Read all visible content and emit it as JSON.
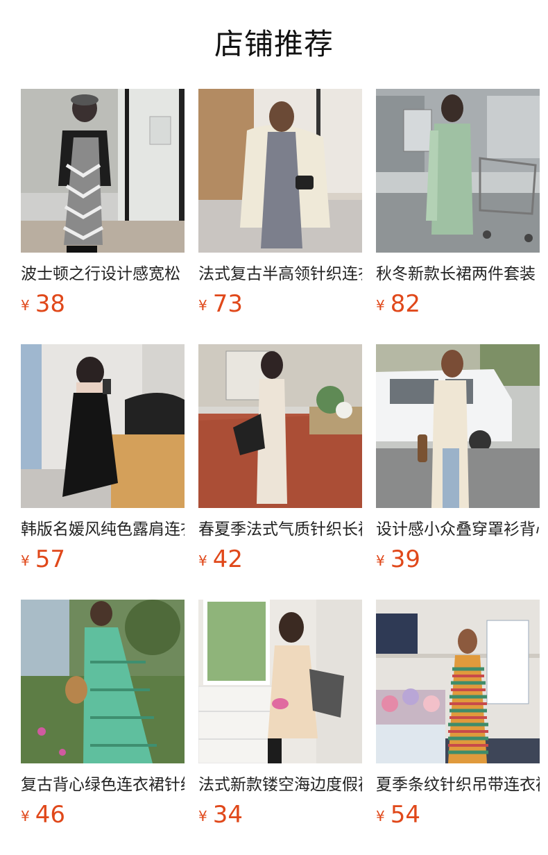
{
  "page_title": "店铺推荐",
  "currency_symbol": "¥",
  "colors": {
    "price": "#e0481a",
    "title": "#111111"
  },
  "products": [
    {
      "name": "波士顿之行设计感宽松",
      "price": "38",
      "image": "woman-leather-jacket-chevron-knit-dress"
    },
    {
      "name": "法式复古半高领针织连衣裙",
      "price": "73",
      "image": "woman-grey-knit-dress-on-cream-sofa"
    },
    {
      "name": "秋冬新款长裙两件套装",
      "price": "82",
      "image": "woman-mint-cardigan-set-in-supermarket"
    },
    {
      "name": "韩版名媛风纯色露肩连衣裙",
      "price": "57",
      "image": "woman-black-tube-dress-mirror-selfie"
    },
    {
      "name": "春夏季法式气质针织长裙",
      "price": "42",
      "image": "woman-cream-crochet-dress-street"
    },
    {
      "name": "设计感小众叠穿罩衫背心",
      "price": "39",
      "image": "woman-cream-long-vest-jeans-by-car"
    },
    {
      "name": "复古背心绿色连衣裙针织",
      "price": "46",
      "image": "woman-green-crochet-dress-garden"
    },
    {
      "name": "法式新款镂空海边度假裙",
      "price": "34",
      "image": "woman-beige-crochet-dress-living-room"
    },
    {
      "name": "夏季条纹针织吊带连衣裙",
      "price": "54",
      "image": "woman-rainbow-stripe-knit-dress-flowers"
    }
  ]
}
